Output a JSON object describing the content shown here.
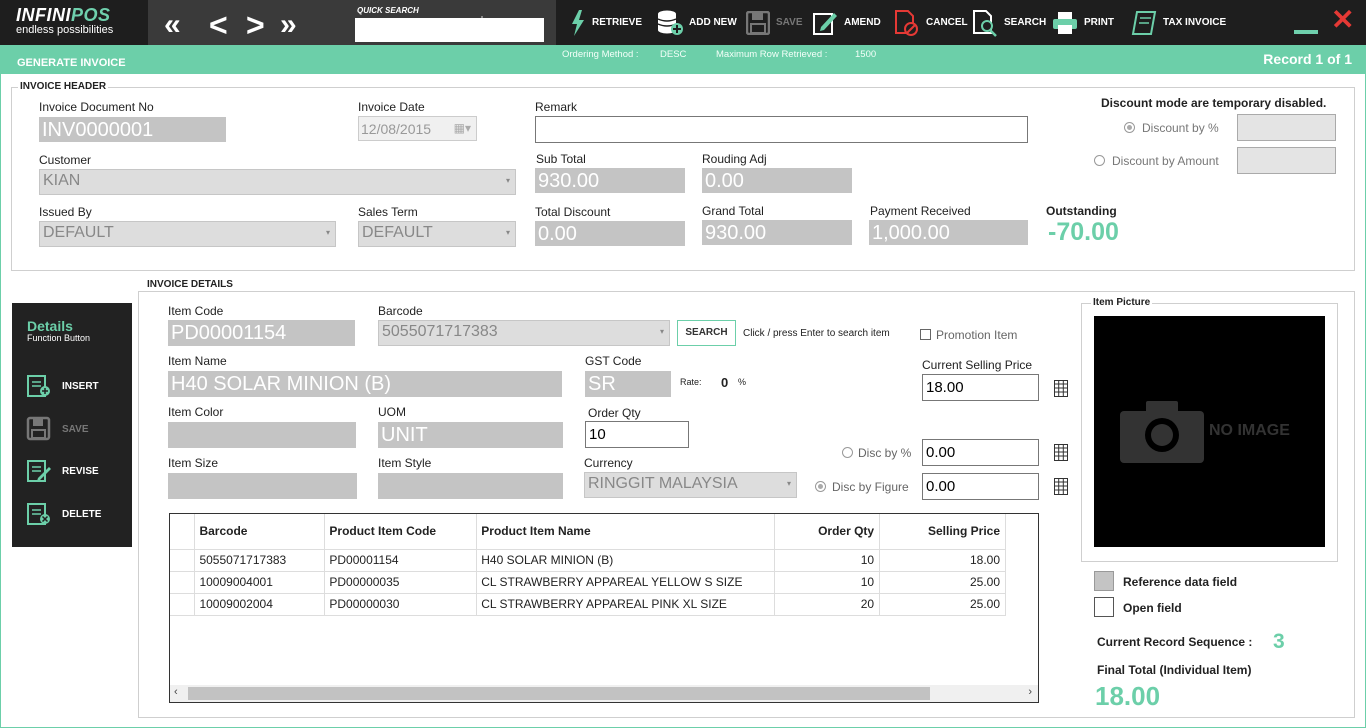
{
  "app": {
    "logo_line1a": "INFINI",
    "logo_line1b": "POS",
    "logo_line2": "endless possibilities"
  },
  "nav": {
    "first": "«",
    "prev": "<",
    "next": ">",
    "last": "»",
    "quick_search_label": "QUICK SEARCH",
    "quick_search_value": ""
  },
  "toolbar": {
    "retrieve": "RETRIEVE",
    "add_new": "ADD NEW",
    "save": "SAVE",
    "amend": "AMEND",
    "cancel": "CANCEL",
    "search": "SEARCH",
    "print": "PRINT",
    "tax_invoice": "TAX INVOICE"
  },
  "window": {
    "close": "✕"
  },
  "subbar": {
    "title": "GENERATE INVOICE",
    "ordering_label": "Ordering Method :",
    "ordering_value": "DESC",
    "maxrow_label": "Maximum Row Retrieved :",
    "maxrow_value": "1500",
    "record": "Record 1 of 1"
  },
  "header": {
    "legend": "INVOICE HEADER",
    "doc_no_label": "Invoice Document No",
    "doc_no": "INV0000001",
    "date_label": "Invoice Date",
    "date": "12/08/2015",
    "remark_label": "Remark",
    "remark": "",
    "customer_label": "Customer",
    "customer": "KIAN",
    "issued_by_label": "Issued By",
    "issued_by": "DEFAULT",
    "sales_term_label": "Sales Term",
    "sales_term": "DEFAULT",
    "sub_total_label": "Sub Total",
    "sub_total": "930.00",
    "rounding_label": "Rouding Adj",
    "rounding": "0.00",
    "total_discount_label": "Total Discount",
    "total_discount": "0.00",
    "grand_total_label": "Grand Total",
    "grand_total": "930.00",
    "payment_label": "Payment Received",
    "payment": "1,000.00",
    "outstanding_label": "Outstanding",
    "outstanding": "-70.00",
    "discount_note": "Discount mode are temporary disabled.",
    "disc_pct_label": "Discount by %",
    "disc_amt_label": "Discount by Amount"
  },
  "details": {
    "legend": "INVOICE DETAILS",
    "item_code_label": "Item Code",
    "item_code": "PD00001154",
    "barcode_label": "Barcode",
    "barcode": "5055071717383",
    "search_btn": "SEARCH",
    "search_hint": "Click / press Enter to search item",
    "promo_label": "Promotion Item",
    "item_name_label": "Item Name",
    "item_name": "H40 SOLAR MINION (B)",
    "gst_label": "GST Code",
    "gst": "SR",
    "rate_label": "Rate:",
    "rate": "0",
    "rate_unit": "%",
    "csp_label": "Current Selling Price",
    "csp": "18.00",
    "color_label": "Item Color",
    "color": "",
    "uom_label": "UOM",
    "uom": "UNIT",
    "order_qty_label": "Order Qty",
    "order_qty": "10",
    "size_label": "Item Size",
    "size": "",
    "style_label": "Item Style",
    "style": "",
    "currency_label": "Currency",
    "currency": "RINGGIT MALAYSIA",
    "disc_pct_label": "Disc by %",
    "disc_pct": "0.00",
    "disc_fig_label": "Disc by Figure",
    "disc_fig": "0.00"
  },
  "leftpanel": {
    "title": "Details",
    "subtitle": "Function Button",
    "insert": "INSERT",
    "save": "SAVE",
    "revise": "REVISE",
    "delete": "DELETE"
  },
  "table": {
    "columns": [
      "Barcode",
      "Product Item Code",
      "Product Item Name",
      "Order Qty",
      "Selling Price"
    ],
    "rows": [
      [
        "5055071717383",
        "PD00001154",
        "H40 SOLAR MINION (B)",
        "10",
        "18.00"
      ],
      [
        "10009004001",
        "PD00000035",
        "CL STRAWBERRY APPAREAL YELLOW S SIZE",
        "10",
        "25.00"
      ],
      [
        "10009002004",
        "PD00000030",
        "CL STRAWBERRY APPAREAL PINK XL SIZE",
        "20",
        "25.00"
      ]
    ]
  },
  "picture": {
    "legend": "Item Picture",
    "no_image": "NO IMAGE"
  },
  "legend_keys": {
    "reference": "Reference data field",
    "open": "Open field"
  },
  "footer": {
    "seq_label": "Current Record Sequence :",
    "seq": "3",
    "final_label": "Final Total (Individual Item)",
    "final": "18.00"
  },
  "colors": {
    "accent": "#6ccfa9",
    "dark": "#1e1e1e",
    "reference": "#c4c4c4",
    "cancel": "#e53935"
  }
}
